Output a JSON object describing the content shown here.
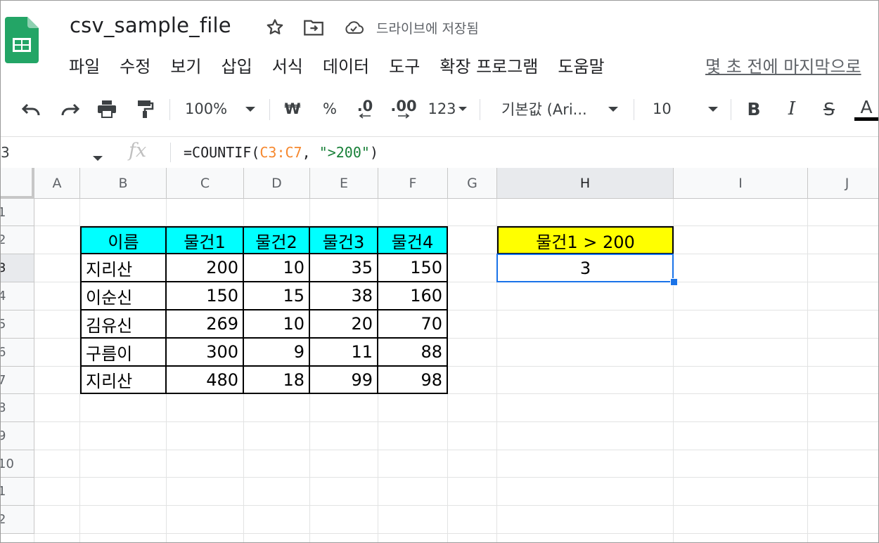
{
  "app": {
    "doc_title": "csv_sample_file",
    "save_status": "드라이브에 저장됨",
    "menu": [
      "파일",
      "수정",
      "보기",
      "삽입",
      "서식",
      "데이터",
      "도구",
      "확장 프로그램",
      "도움말"
    ],
    "last_edit": "몇 초 전에 마지막으로"
  },
  "toolbar": {
    "zoom": "100%",
    "currency": "₩",
    "percent": "%",
    "dec_decrease": ".0",
    "dec_increase": ".00",
    "format_more": "123",
    "font_family": "기본값 (Ari...",
    "font_size": "10",
    "bold": "B",
    "italic": "I",
    "strike": "S",
    "text_color": "A"
  },
  "formula_bar": {
    "name_box": "3",
    "fx": "fx",
    "formula_prefix": "=COUNTIF(",
    "formula_ref": "C3:C7",
    "formula_mid": ", ",
    "formula_str": "\">200\"",
    "formula_suffix": ")"
  },
  "grid": {
    "columns": [
      "A",
      "B",
      "C",
      "D",
      "E",
      "F",
      "G",
      "H",
      "I",
      "J"
    ],
    "rows": [
      "1",
      "2",
      "3",
      "4",
      "5",
      "6",
      "7",
      "8",
      "9",
      "10",
      "1",
      "2"
    ],
    "table": {
      "headers": [
        "이름",
        "물건1",
        "물건2",
        "물건3",
        "물건4"
      ],
      "rows": [
        [
          "지리산",
          "200",
          "10",
          "35",
          "150"
        ],
        [
          "이순신",
          "150",
          "15",
          "38",
          "160"
        ],
        [
          "김유신",
          "269",
          "10",
          "20",
          "70"
        ],
        [
          "구름이",
          "300",
          "9",
          "11",
          "88"
        ],
        [
          "지리산",
          "480",
          "18",
          "99",
          "98"
        ]
      ]
    },
    "result_header": "물건1 > 200",
    "result_value": "3"
  },
  "colors": {
    "header_cyan": "#00ffff",
    "header_yellow": "#ffff00",
    "selection": "#1a73e8",
    "formula_ref": "#f6882e",
    "formula_string": "#188038"
  }
}
